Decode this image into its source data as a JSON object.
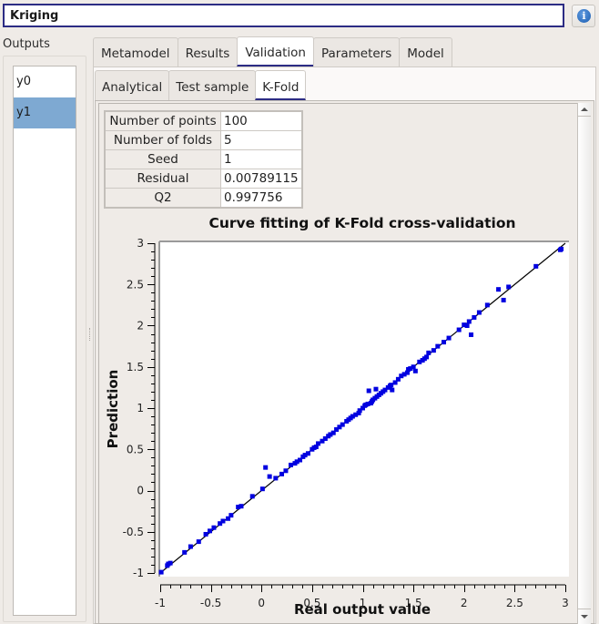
{
  "title_field": "Kriging",
  "info_button": "info-icon",
  "outputs": {
    "label": "Outputs",
    "items": [
      {
        "label": "y0",
        "selected": false
      },
      {
        "label": "y1",
        "selected": true
      }
    ]
  },
  "tabs": [
    {
      "label": "Metamodel",
      "active": false
    },
    {
      "label": "Results",
      "active": false
    },
    {
      "label": "Validation",
      "active": true
    },
    {
      "label": "Parameters",
      "active": false
    },
    {
      "label": "Model",
      "active": false
    }
  ],
  "subtabs": [
    {
      "label": "Analytical",
      "active": false
    },
    {
      "label": "Test sample",
      "active": false
    },
    {
      "label": "K-Fold",
      "active": true
    }
  ],
  "info_table": [
    {
      "key": "Number of points",
      "value": "100"
    },
    {
      "key": "Number of folds",
      "value": "5"
    },
    {
      "key": "Seed",
      "value": "1"
    },
    {
      "key": "Residual",
      "value": "0.00789115"
    },
    {
      "key": "Q2",
      "value": "0.997756"
    }
  ],
  "colors": {
    "accent": "#2c2c84",
    "selection": "#7ea9d2",
    "points": "#0000e0",
    "line": "#000000"
  },
  "chart_data": {
    "type": "scatter",
    "title": "Curve fitting of K-Fold cross-validation",
    "xlabel": "Real output value",
    "ylabel": "Prediction",
    "xlim": [
      -1,
      3
    ],
    "ylim": [
      -1,
      3
    ],
    "xticks": [
      "-1",
      "-0.5",
      "0",
      "0.5",
      "1",
      "1.5",
      "2",
      "2.5",
      "3"
    ],
    "yticks": [
      "-1",
      "-0.5",
      "0",
      "0.5",
      "1",
      "1.5",
      "2",
      "2.5",
      "3"
    ],
    "grid": false,
    "reference_line": {
      "from": [
        -1,
        -1
      ],
      "to": [
        3,
        3
      ]
    },
    "points": [
      [
        -0.99,
        -0.99
      ],
      [
        -0.93,
        -0.91
      ],
      [
        -0.92,
        -0.89
      ],
      [
        -0.76,
        -0.75
      ],
      [
        -0.7,
        -0.68
      ],
      [
        -0.51,
        -0.49
      ],
      [
        -0.47,
        -0.45
      ],
      [
        -0.41,
        -0.4
      ],
      [
        -0.38,
        -0.37
      ],
      [
        -0.33,
        -0.34
      ],
      [
        -0.3,
        -0.3
      ],
      [
        -0.23,
        -0.2
      ],
      [
        -0.09,
        -0.07
      ],
      [
        0.01,
        0.02
      ],
      [
        0.04,
        0.28
      ],
      [
        0.08,
        0.17
      ],
      [
        0.14,
        0.15
      ],
      [
        0.29,
        0.31
      ],
      [
        0.33,
        0.33
      ],
      [
        0.35,
        0.35
      ],
      [
        0.41,
        0.41
      ],
      [
        0.43,
        0.43
      ],
      [
        0.46,
        0.45
      ],
      [
        0.52,
        0.52
      ],
      [
        0.54,
        0.53
      ],
      [
        0.6,
        0.6
      ],
      [
        0.63,
        0.63
      ],
      [
        0.68,
        0.68
      ],
      [
        0.71,
        0.7
      ],
      [
        0.74,
        0.74
      ],
      [
        0.8,
        0.8
      ],
      [
        0.86,
        0.86
      ],
      [
        0.88,
        0.88
      ],
      [
        0.93,
        0.92
      ],
      [
        0.96,
        0.94
      ],
      [
        1.0,
        1.0
      ],
      [
        1.02,
        1.03
      ],
      [
        1.05,
        1.05
      ],
      [
        1.08,
        1.06
      ],
      [
        1.1,
        1.1
      ],
      [
        1.12,
        1.12
      ],
      [
        1.14,
        1.14
      ],
      [
        1.06,
        1.21
      ],
      [
        1.13,
        1.23
      ],
      [
        1.16,
        1.16
      ],
      [
        1.2,
        1.2
      ],
      [
        1.25,
        1.25
      ],
      [
        1.29,
        1.22
      ],
      [
        1.28,
        1.28
      ],
      [
        1.32,
        1.31
      ],
      [
        1.38,
        1.39
      ],
      [
        1.41,
        1.41
      ],
      [
        1.45,
        1.47
      ],
      [
        1.5,
        1.5
      ],
      [
        1.52,
        1.45
      ],
      [
        1.56,
        1.56
      ],
      [
        1.59,
        1.58
      ],
      [
        1.63,
        1.62
      ],
      [
        1.65,
        1.67
      ],
      [
        1.74,
        1.75
      ],
      [
        1.8,
        1.8
      ],
      [
        2.03,
        2.0
      ],
      [
        2.05,
        2.05
      ],
      [
        2.07,
        1.89
      ],
      [
        2.23,
        2.25
      ],
      [
        2.34,
        2.44
      ],
      [
        2.39,
        2.31
      ],
      [
        2.44,
        2.47
      ],
      [
        2.71,
        2.72
      ],
      [
        2.95,
        2.92
      ],
      [
        2.96,
        2.93
      ],
      [
        -0.9,
        -0.88
      ],
      [
        -0.55,
        -0.53
      ],
      [
        -0.2,
        -0.19
      ],
      [
        0.2,
        0.2
      ],
      [
        0.38,
        0.37
      ],
      [
        0.5,
        0.5
      ],
      [
        0.66,
        0.66
      ],
      [
        0.77,
        0.77
      ],
      [
        0.9,
        0.9
      ],
      [
        0.97,
        0.97
      ],
      [
        1.03,
        1.04
      ],
      [
        1.09,
        1.08
      ],
      [
        1.18,
        1.18
      ],
      [
        1.22,
        1.22
      ],
      [
        1.35,
        1.35
      ],
      [
        1.44,
        1.43
      ],
      [
        1.47,
        1.48
      ],
      [
        1.61,
        1.6
      ],
      [
        1.7,
        1.7
      ],
      [
        1.85,
        1.85
      ],
      [
        1.95,
        1.95
      ],
      [
        2.0,
        2.01
      ],
      [
        2.1,
        2.1
      ],
      [
        2.15,
        2.16
      ],
      [
        1.27,
        1.27
      ],
      [
        0.84,
        0.84
      ],
      [
        0.56,
        0.57
      ],
      [
        0.24,
        0.24
      ],
      [
        -0.62,
        -0.62
      ]
    ]
  }
}
